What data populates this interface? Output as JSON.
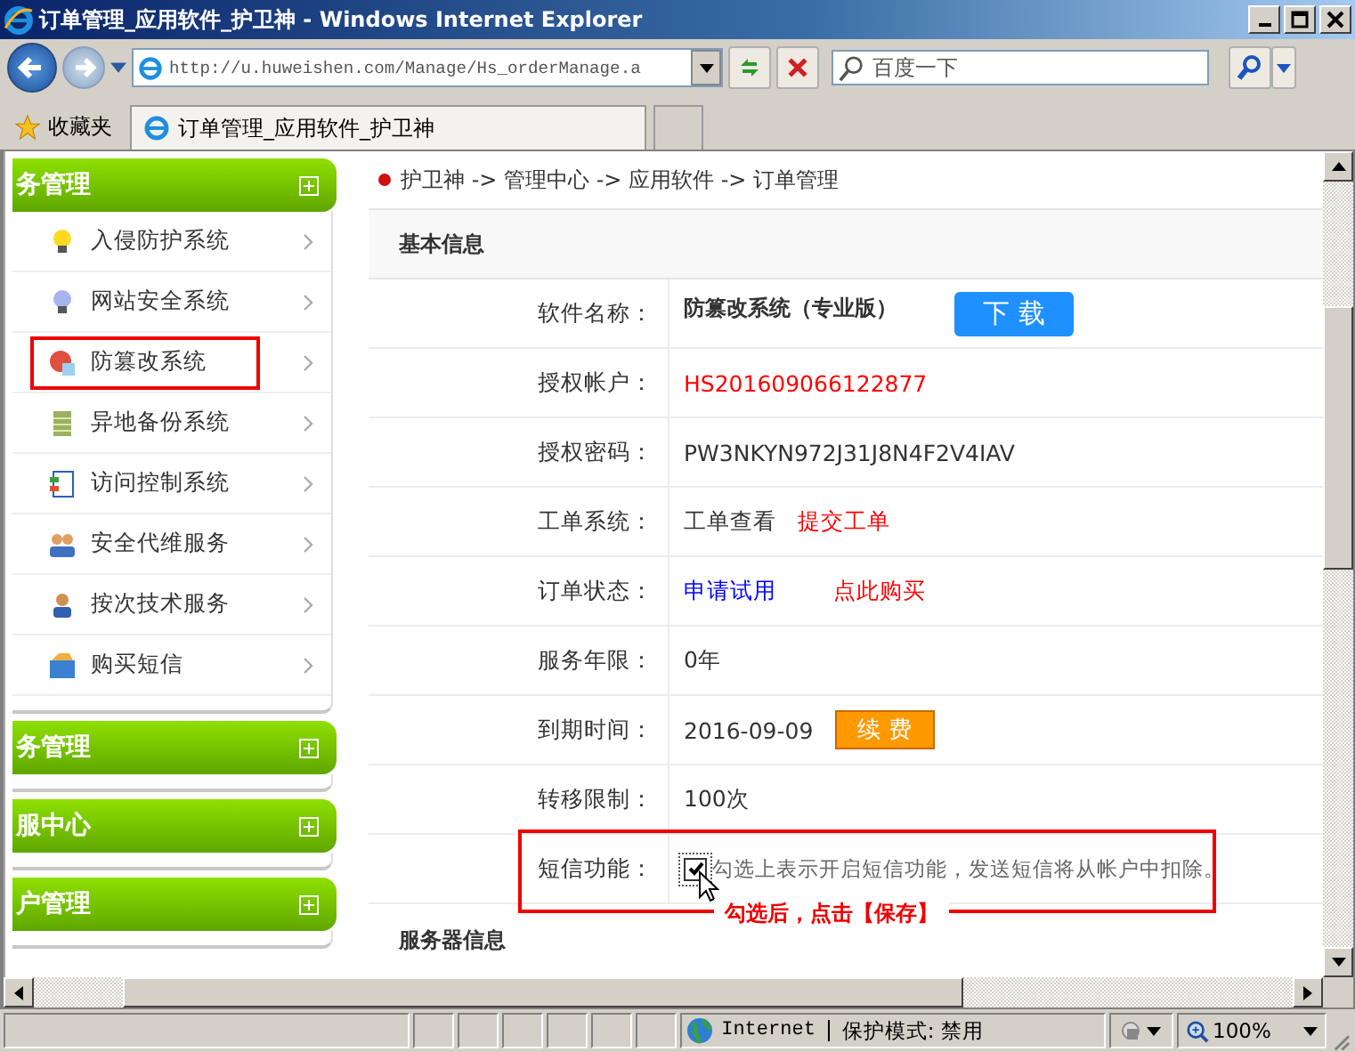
{
  "window": {
    "title": "订单管理_应用软件_护卫神 - Windows Internet Explorer"
  },
  "toolbar": {
    "address": "http://u.huweishen.com/Manage/Hs_orderManage.a",
    "search_placeholder": "百度一下"
  },
  "favorites": {
    "label": "收藏夹",
    "tab": "订单管理_应用软件_护卫神"
  },
  "sidebar": [
    {
      "title": "务管理",
      "items": [
        {
          "label": "入侵防护系统",
          "selected": false
        },
        {
          "label": "网站安全系统",
          "selected": false
        },
        {
          "label": "防篡改系统",
          "selected": true
        },
        {
          "label": "异地备份系统",
          "selected": false
        },
        {
          "label": "访问控制系统",
          "selected": false
        },
        {
          "label": "安全代维服务",
          "selected": false
        },
        {
          "label": "按次技术服务",
          "selected": false
        },
        {
          "label": "购买短信",
          "selected": false
        }
      ]
    },
    {
      "title": "务管理"
    },
    {
      "title": "服中心"
    },
    {
      "title": "户管理"
    }
  ],
  "breadcrumb": "护卫神 -> 管理中心 -> 应用软件 -> 订单管理",
  "section_title": "基本信息",
  "rows": [
    {
      "label": "软件名称：",
      "parts": [
        {
          "text": "防篡改系统（专业版）",
          "kind": "bold"
        },
        {
          "text": "下 载",
          "kind": "button-blue"
        }
      ]
    },
    {
      "label": "授权帐户：",
      "parts": [
        {
          "text": "HS201609066122877",
          "kind": "red"
        }
      ]
    },
    {
      "label": "授权密码：",
      "parts": [
        {
          "text": "PW3NKYN972J31J8N4F2V4IAV",
          "kind": "plain"
        }
      ]
    },
    {
      "label": "工单系统：",
      "parts": [
        {
          "text": "工单查看",
          "kind": "plain"
        },
        {
          "text": "提交工单",
          "kind": "red-link"
        }
      ]
    },
    {
      "label": "订单状态：",
      "parts": [
        {
          "text": "申请试用",
          "kind": "blue-link"
        },
        {
          "text": "点此购买",
          "kind": "red-link"
        }
      ]
    },
    {
      "label": "服务年限：",
      "parts": [
        {
          "text": "0年",
          "kind": "plain"
        }
      ]
    },
    {
      "label": "到期时间：",
      "parts": [
        {
          "text": "2016-09-09",
          "kind": "plain"
        },
        {
          "text": "续 费",
          "kind": "button-orange"
        }
      ]
    },
    {
      "label": "转移限制：",
      "parts": [
        {
          "text": "100次",
          "kind": "plain"
        }
      ]
    },
    {
      "label": "短信功能：",
      "highlighted": true,
      "parts": [
        {
          "kind": "checkbox",
          "checked": true
        },
        {
          "text": "勾选上表示开启短信功能，发送短信将从帐户中扣除。",
          "kind": "hint"
        }
      ],
      "annotation": "勾选后，点击【保存】"
    }
  ],
  "next_section_title": "服务器信息",
  "status_bar": {
    "zone": "Internet",
    "mode": "保护模式: 禁用",
    "zoom": "100%"
  }
}
